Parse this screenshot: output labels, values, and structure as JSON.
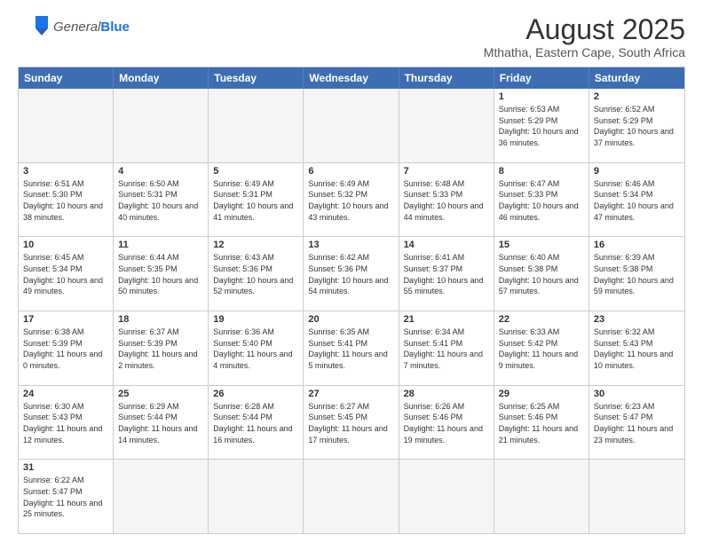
{
  "logo": {
    "text_general": "General",
    "text_blue": "Blue"
  },
  "header": {
    "month_title": "August 2025",
    "location": "Mthatha, Eastern Cape, South Africa"
  },
  "weekdays": [
    "Sunday",
    "Monday",
    "Tuesday",
    "Wednesday",
    "Thursday",
    "Friday",
    "Saturday"
  ],
  "weeks": [
    [
      {
        "day": "",
        "empty": true,
        "info": ""
      },
      {
        "day": "",
        "empty": true,
        "info": ""
      },
      {
        "day": "",
        "empty": true,
        "info": ""
      },
      {
        "day": "",
        "empty": true,
        "info": ""
      },
      {
        "day": "",
        "empty": true,
        "info": ""
      },
      {
        "day": "1",
        "empty": false,
        "info": "Sunrise: 6:53 AM\nSunset: 5:29 PM\nDaylight: 10 hours and 36 minutes."
      },
      {
        "day": "2",
        "empty": false,
        "info": "Sunrise: 6:52 AM\nSunset: 5:29 PM\nDaylight: 10 hours and 37 minutes."
      }
    ],
    [
      {
        "day": "3",
        "empty": false,
        "info": "Sunrise: 6:51 AM\nSunset: 5:30 PM\nDaylight: 10 hours and 38 minutes."
      },
      {
        "day": "4",
        "empty": false,
        "info": "Sunrise: 6:50 AM\nSunset: 5:31 PM\nDaylight: 10 hours and 40 minutes."
      },
      {
        "day": "5",
        "empty": false,
        "info": "Sunrise: 6:49 AM\nSunset: 5:31 PM\nDaylight: 10 hours and 41 minutes."
      },
      {
        "day": "6",
        "empty": false,
        "info": "Sunrise: 6:49 AM\nSunset: 5:32 PM\nDaylight: 10 hours and 43 minutes."
      },
      {
        "day": "7",
        "empty": false,
        "info": "Sunrise: 6:48 AM\nSunset: 5:33 PM\nDaylight: 10 hours and 44 minutes."
      },
      {
        "day": "8",
        "empty": false,
        "info": "Sunrise: 6:47 AM\nSunset: 5:33 PM\nDaylight: 10 hours and 46 minutes."
      },
      {
        "day": "9",
        "empty": false,
        "info": "Sunrise: 6:46 AM\nSunset: 5:34 PM\nDaylight: 10 hours and 47 minutes."
      }
    ],
    [
      {
        "day": "10",
        "empty": false,
        "info": "Sunrise: 6:45 AM\nSunset: 5:34 PM\nDaylight: 10 hours and 49 minutes."
      },
      {
        "day": "11",
        "empty": false,
        "info": "Sunrise: 6:44 AM\nSunset: 5:35 PM\nDaylight: 10 hours and 50 minutes."
      },
      {
        "day": "12",
        "empty": false,
        "info": "Sunrise: 6:43 AM\nSunset: 5:36 PM\nDaylight: 10 hours and 52 minutes."
      },
      {
        "day": "13",
        "empty": false,
        "info": "Sunrise: 6:42 AM\nSunset: 5:36 PM\nDaylight: 10 hours and 54 minutes."
      },
      {
        "day": "14",
        "empty": false,
        "info": "Sunrise: 6:41 AM\nSunset: 5:37 PM\nDaylight: 10 hours and 55 minutes."
      },
      {
        "day": "15",
        "empty": false,
        "info": "Sunrise: 6:40 AM\nSunset: 5:38 PM\nDaylight: 10 hours and 57 minutes."
      },
      {
        "day": "16",
        "empty": false,
        "info": "Sunrise: 6:39 AM\nSunset: 5:38 PM\nDaylight: 10 hours and 59 minutes."
      }
    ],
    [
      {
        "day": "17",
        "empty": false,
        "info": "Sunrise: 6:38 AM\nSunset: 5:39 PM\nDaylight: 11 hours and 0 minutes."
      },
      {
        "day": "18",
        "empty": false,
        "info": "Sunrise: 6:37 AM\nSunset: 5:39 PM\nDaylight: 11 hours and 2 minutes."
      },
      {
        "day": "19",
        "empty": false,
        "info": "Sunrise: 6:36 AM\nSunset: 5:40 PM\nDaylight: 11 hours and 4 minutes."
      },
      {
        "day": "20",
        "empty": false,
        "info": "Sunrise: 6:35 AM\nSunset: 5:41 PM\nDaylight: 11 hours and 5 minutes."
      },
      {
        "day": "21",
        "empty": false,
        "info": "Sunrise: 6:34 AM\nSunset: 5:41 PM\nDaylight: 11 hours and 7 minutes."
      },
      {
        "day": "22",
        "empty": false,
        "info": "Sunrise: 6:33 AM\nSunset: 5:42 PM\nDaylight: 11 hours and 9 minutes."
      },
      {
        "day": "23",
        "empty": false,
        "info": "Sunrise: 6:32 AM\nSunset: 5:43 PM\nDaylight: 11 hours and 10 minutes."
      }
    ],
    [
      {
        "day": "24",
        "empty": false,
        "info": "Sunrise: 6:30 AM\nSunset: 5:43 PM\nDaylight: 11 hours and 12 minutes."
      },
      {
        "day": "25",
        "empty": false,
        "info": "Sunrise: 6:29 AM\nSunset: 5:44 PM\nDaylight: 11 hours and 14 minutes."
      },
      {
        "day": "26",
        "empty": false,
        "info": "Sunrise: 6:28 AM\nSunset: 5:44 PM\nDaylight: 11 hours and 16 minutes."
      },
      {
        "day": "27",
        "empty": false,
        "info": "Sunrise: 6:27 AM\nSunset: 5:45 PM\nDaylight: 11 hours and 17 minutes."
      },
      {
        "day": "28",
        "empty": false,
        "info": "Sunrise: 6:26 AM\nSunset: 5:46 PM\nDaylight: 11 hours and 19 minutes."
      },
      {
        "day": "29",
        "empty": false,
        "info": "Sunrise: 6:25 AM\nSunset: 5:46 PM\nDaylight: 11 hours and 21 minutes."
      },
      {
        "day": "30",
        "empty": false,
        "info": "Sunrise: 6:23 AM\nSunset: 5:47 PM\nDaylight: 11 hours and 23 minutes."
      }
    ],
    [
      {
        "day": "31",
        "empty": false,
        "info": "Sunrise: 6:22 AM\nSunset: 5:47 PM\nDaylight: 11 hours and 25 minutes."
      },
      {
        "day": "",
        "empty": true,
        "info": ""
      },
      {
        "day": "",
        "empty": true,
        "info": ""
      },
      {
        "day": "",
        "empty": true,
        "info": ""
      },
      {
        "day": "",
        "empty": true,
        "info": ""
      },
      {
        "day": "",
        "empty": true,
        "info": ""
      },
      {
        "day": "",
        "empty": true,
        "info": ""
      }
    ]
  ]
}
